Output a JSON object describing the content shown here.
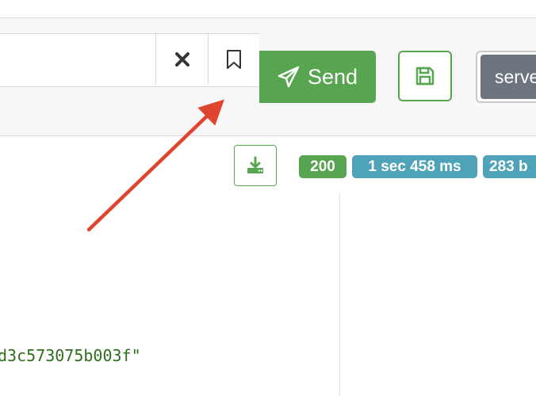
{
  "request": {
    "url_value": "",
    "send_label": "Send",
    "server_label": "serve"
  },
  "response": {
    "status_code": "200",
    "time": "1 sec 458 ms",
    "size": "283 b",
    "body_fragment": "d3c573075b003f\""
  },
  "colors": {
    "success": "#58a551",
    "info": "#4fa3b8",
    "secondary": "#6c757d",
    "annotation_arrow": "#e0442e"
  },
  "icons": {
    "clear": "close-icon",
    "bookmark": "bookmark-icon",
    "send": "paper-plane-icon",
    "save": "floppy-disk-icon",
    "download": "download-icon"
  }
}
